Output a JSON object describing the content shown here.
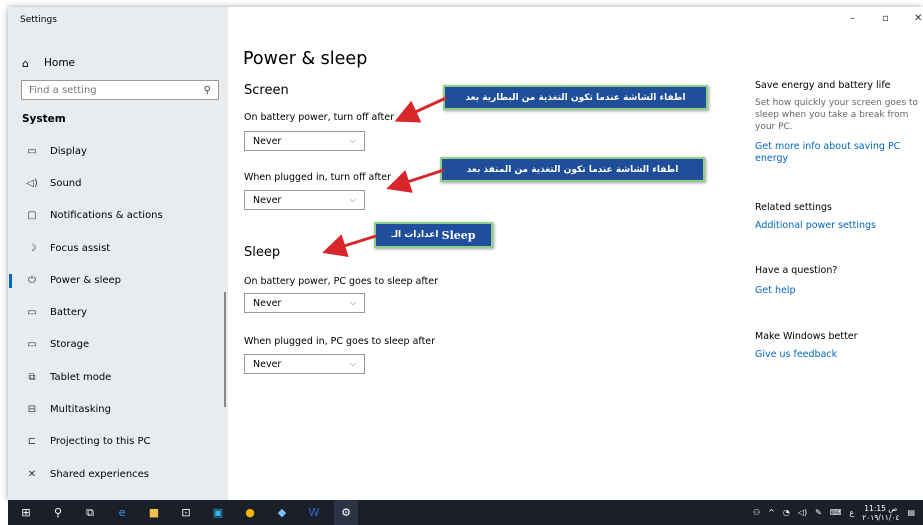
{
  "window": {
    "title": "Settings",
    "minimize": "–",
    "maximize": "▫",
    "close": "✕"
  },
  "sidebar": {
    "home_label": "Home",
    "search_placeholder": "Find a setting",
    "section_label": "System",
    "items": [
      {
        "label": "Display",
        "icon": "display-icon",
        "glyph": "▭"
      },
      {
        "label": "Sound",
        "icon": "sound-icon",
        "glyph": "◁)"
      },
      {
        "label": "Notifications & actions",
        "icon": "notifications-icon",
        "glyph": "▢"
      },
      {
        "label": "Focus assist",
        "icon": "moon-icon",
        "glyph": "☽"
      },
      {
        "label": "Power & sleep",
        "icon": "power-icon",
        "glyph": "⏻"
      },
      {
        "label": "Battery",
        "icon": "battery-icon",
        "glyph": "▭"
      },
      {
        "label": "Storage",
        "icon": "storage-icon",
        "glyph": "▭"
      },
      {
        "label": "Tablet mode",
        "icon": "tablet-icon",
        "glyph": "⧉"
      },
      {
        "label": "Multitasking",
        "icon": "multitasking-icon",
        "glyph": "⊟"
      },
      {
        "label": "Projecting to this PC",
        "icon": "projecting-icon",
        "glyph": "⊏"
      },
      {
        "label": "Shared experiences",
        "icon": "shared-icon",
        "glyph": "✕"
      }
    ]
  },
  "main": {
    "title": "Power & sleep",
    "screen_heading": "Screen",
    "screen_battery_label": "On battery power, turn off after",
    "screen_battery_value": "Never",
    "screen_plugged_label": "When plugged in, turn off after",
    "screen_plugged_value": "Never",
    "sleep_heading": "Sleep",
    "sleep_battery_label": "On battery power, PC goes to sleep after",
    "sleep_battery_value": "Never",
    "sleep_plugged_label": "When plugged in, PC goes to sleep after",
    "sleep_plugged_value": "Never"
  },
  "related": {
    "save_heading": "Save energy and battery life",
    "save_text": "Set how quickly your screen goes to sleep when you take a break from your PC.",
    "save_link": "Get more info about saving PC energy",
    "related_heading": "Related settings",
    "related_link": "Additional power settings",
    "question_heading": "Have a question?",
    "question_link": "Get help",
    "better_heading": "Make Windows better",
    "better_link": "Give us feedback"
  },
  "callouts": {
    "battery": "اطفاء الشاشة عندما تكون التغذية من البطارية بعد",
    "plugged": "اطفاء الشاشة عندما تكون التغذية من المنفذ بعد",
    "sleep_word": "Sleep",
    "sleep_prefix": "اعدادات الـ"
  },
  "taskbar": {
    "clock_time": "11:15 ص",
    "clock_date": "٢٠١٩/١١/٠٤",
    "lang": "ع"
  },
  "colors": {
    "accent": "#0067c0",
    "callout_bg": "#1f4e9a",
    "callout_border": "#8ed086",
    "arrow": "#d9262a",
    "taskbar": "#1b1f2a"
  }
}
